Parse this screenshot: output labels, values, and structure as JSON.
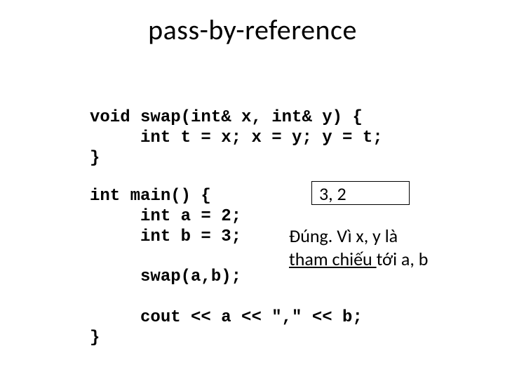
{
  "title": "pass-by-reference",
  "code": {
    "block1_line1": "void swap(int& x, int& y) {",
    "block1_line2": "     int t = x; x = y; y = t;",
    "block1_line3": "}",
    "block2_line1": "int main() {",
    "block2_line2": "     int a = 2;",
    "block2_line3": "     int b = 3;",
    "block2_line4": "",
    "block2_line5": "     swap(a,b);",
    "block2_line6": "",
    "block2_line7": "     cout << a << \",\" << b;",
    "block2_line8": "}"
  },
  "output": "3, 2",
  "explain": {
    "line1": "Đúng. Vì x, y là",
    "line2_pre": "tham chiếu ",
    "line2_post": "tới a, b"
  }
}
